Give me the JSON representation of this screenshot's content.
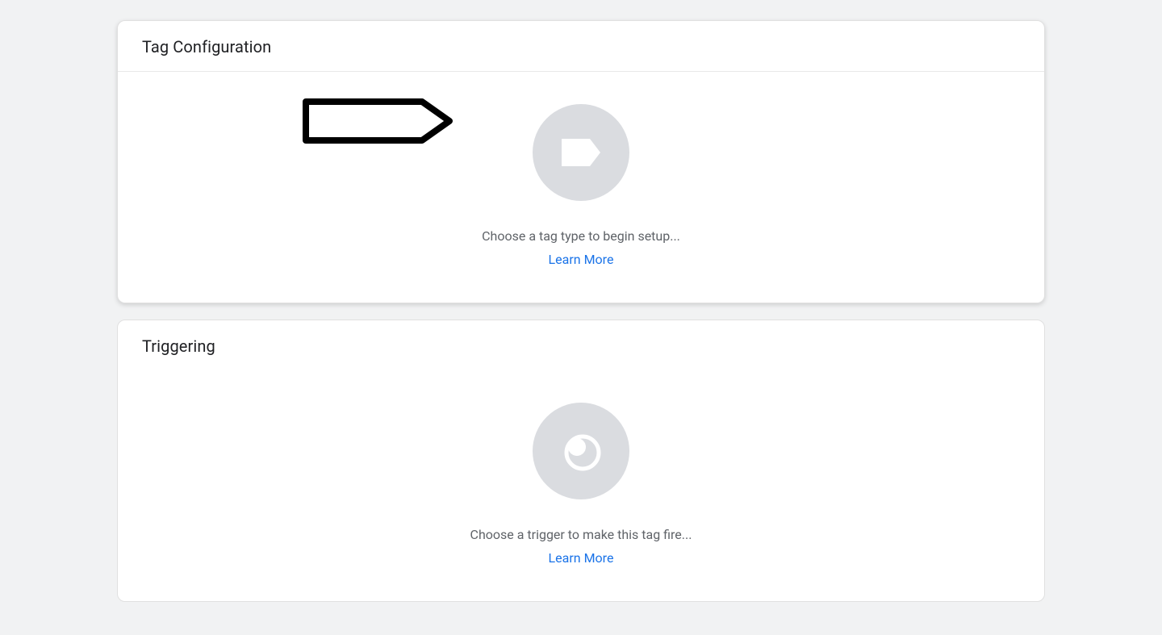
{
  "cards": {
    "tag_config": {
      "title": "Tag Configuration",
      "prompt": "Choose a tag type to begin setup...",
      "learn_more": "Learn More"
    },
    "triggering": {
      "title": "Triggering",
      "prompt": "Choose a trigger to make this tag fire...",
      "learn_more": "Learn More"
    }
  },
  "link_color": "#1a73e8"
}
